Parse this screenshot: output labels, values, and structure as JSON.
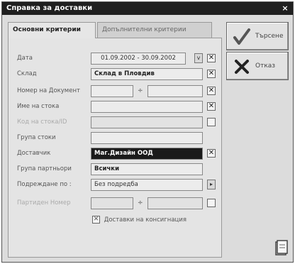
{
  "window": {
    "title": "Справка за доставки",
    "close_glyph": "×"
  },
  "tabs": [
    {
      "label": "Основни критерии",
      "active": true
    },
    {
      "label": "Допълнителни критерии",
      "active": false
    }
  ],
  "form": {
    "date": {
      "label": "Дата",
      "value": "01.09.2002 - 30.09.2002",
      "dropdown": "v",
      "checked": "✕"
    },
    "warehouse": {
      "label": "Склад",
      "value": "Склад в Пловдив",
      "checked": "✕"
    },
    "doc_no": {
      "label": "Номер на Документ",
      "from": "",
      "separator": "÷",
      "to": "",
      "checked": "✕"
    },
    "product_name": {
      "label": "Име на стока",
      "value": "",
      "checked": "✕"
    },
    "product_code": {
      "label": "Код на стока/ID",
      "value": "",
      "checked": ""
    },
    "product_group": {
      "label": "Група стоки",
      "value": ""
    },
    "supplier": {
      "label": "Доставчик",
      "value": "Маг.Дизайн ООД",
      "checked": "✕"
    },
    "supplier_group": {
      "label": "Група партньори",
      "value": "Всички"
    },
    "sort_by": {
      "label": "Подреждане по :",
      "value": "Без подредба",
      "button": "▸"
    },
    "lot_no": {
      "label": "Партиден Номер",
      "from": "",
      "separator": "÷",
      "to": "",
      "checked": ""
    },
    "consignment": {
      "label": "Доставки на консигнация",
      "checked": "✕"
    }
  },
  "buttons": {
    "search": {
      "label": "Търсене",
      "icon": "checkmark-icon"
    },
    "cancel": {
      "label": "Отказ",
      "icon": "x-mark-icon"
    }
  },
  "colors": {
    "titlebar": "#1f1f1f",
    "window_bg": "#dcdcdc",
    "highlight_field": "#1a1a1a"
  }
}
